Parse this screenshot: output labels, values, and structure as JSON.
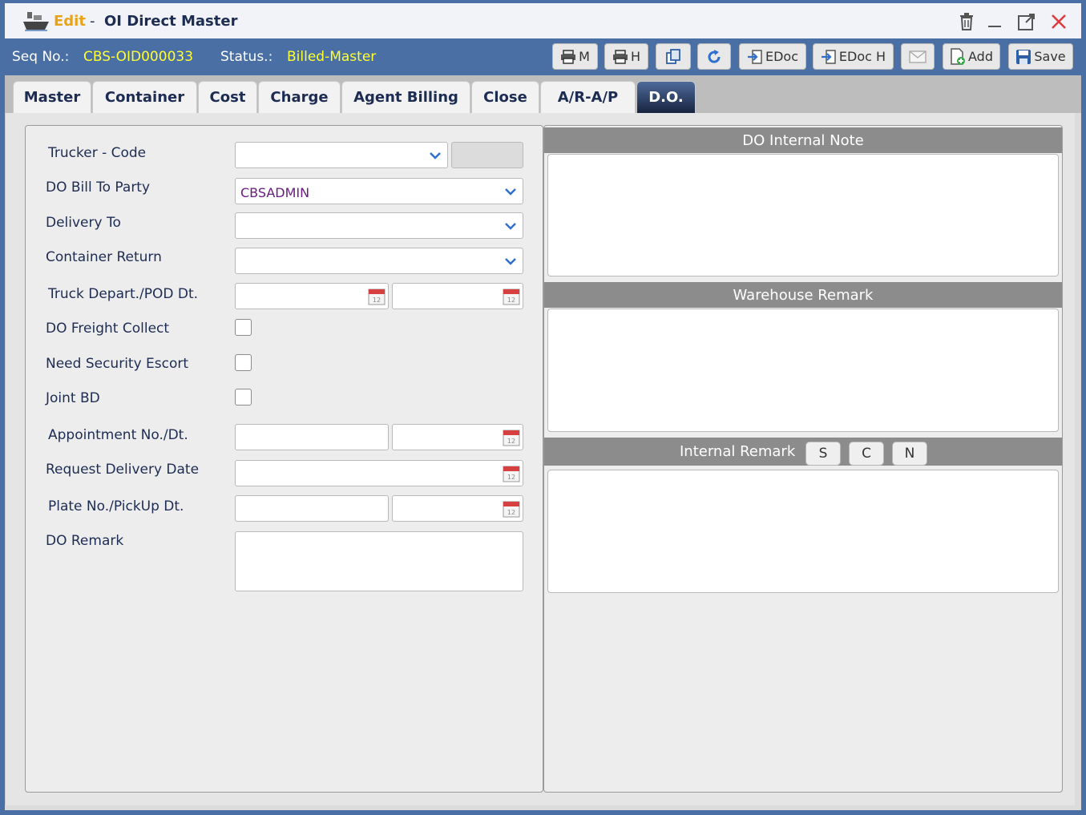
{
  "window": {
    "title_mode": "Edit",
    "title_separator": "-",
    "title_name": "OI Direct Master"
  },
  "info": {
    "seq_label": "Seq No.:",
    "seq_value": "CBS-OID000033",
    "status_label": "Status.:",
    "status_value": "Billed-Master"
  },
  "toolbar": {
    "print_m": "M",
    "print_h": "H",
    "edoc": "EDoc",
    "edoc_h": "EDoc H",
    "add": "Add",
    "save": "Save"
  },
  "tabs": [
    "Master",
    "Container",
    "Cost",
    "Charge",
    "Agent Billing",
    "Close",
    "A/R-A/P",
    "D.O."
  ],
  "active_tab": "D.O.",
  "form": {
    "trucker_label": "Trucker - Code",
    "bill_to_label": "DO Bill To Party",
    "bill_to_value": "CBSADMIN",
    "delivery_to_label": "Delivery To",
    "container_return_label": "Container Return",
    "truck_depart_label": "Truck Depart./POD Dt.",
    "freight_collect_label": "DO Freight Collect",
    "security_escort_label": "Need Security Escort",
    "joint_bd_label": "Joint BD",
    "appointment_label": "Appointment No./Dt.",
    "request_delivery_label": "Request Delivery Date",
    "plate_label": "Plate No./PickUp Dt.",
    "do_remark_label": "DO Remark"
  },
  "right": {
    "internal_note": "DO Internal Note",
    "warehouse_remark": "Warehouse Remark",
    "internal_remark": "Internal Remark",
    "btn_s": "S",
    "btn_c": "C",
    "btn_n": "N"
  },
  "colors": {
    "brand_blue": "#4a6fa5",
    "title_navy": "#1d2c52",
    "edit_orange": "#e8a317",
    "status_yellow": "#ffff33",
    "value_purple": "#6b1b83"
  }
}
